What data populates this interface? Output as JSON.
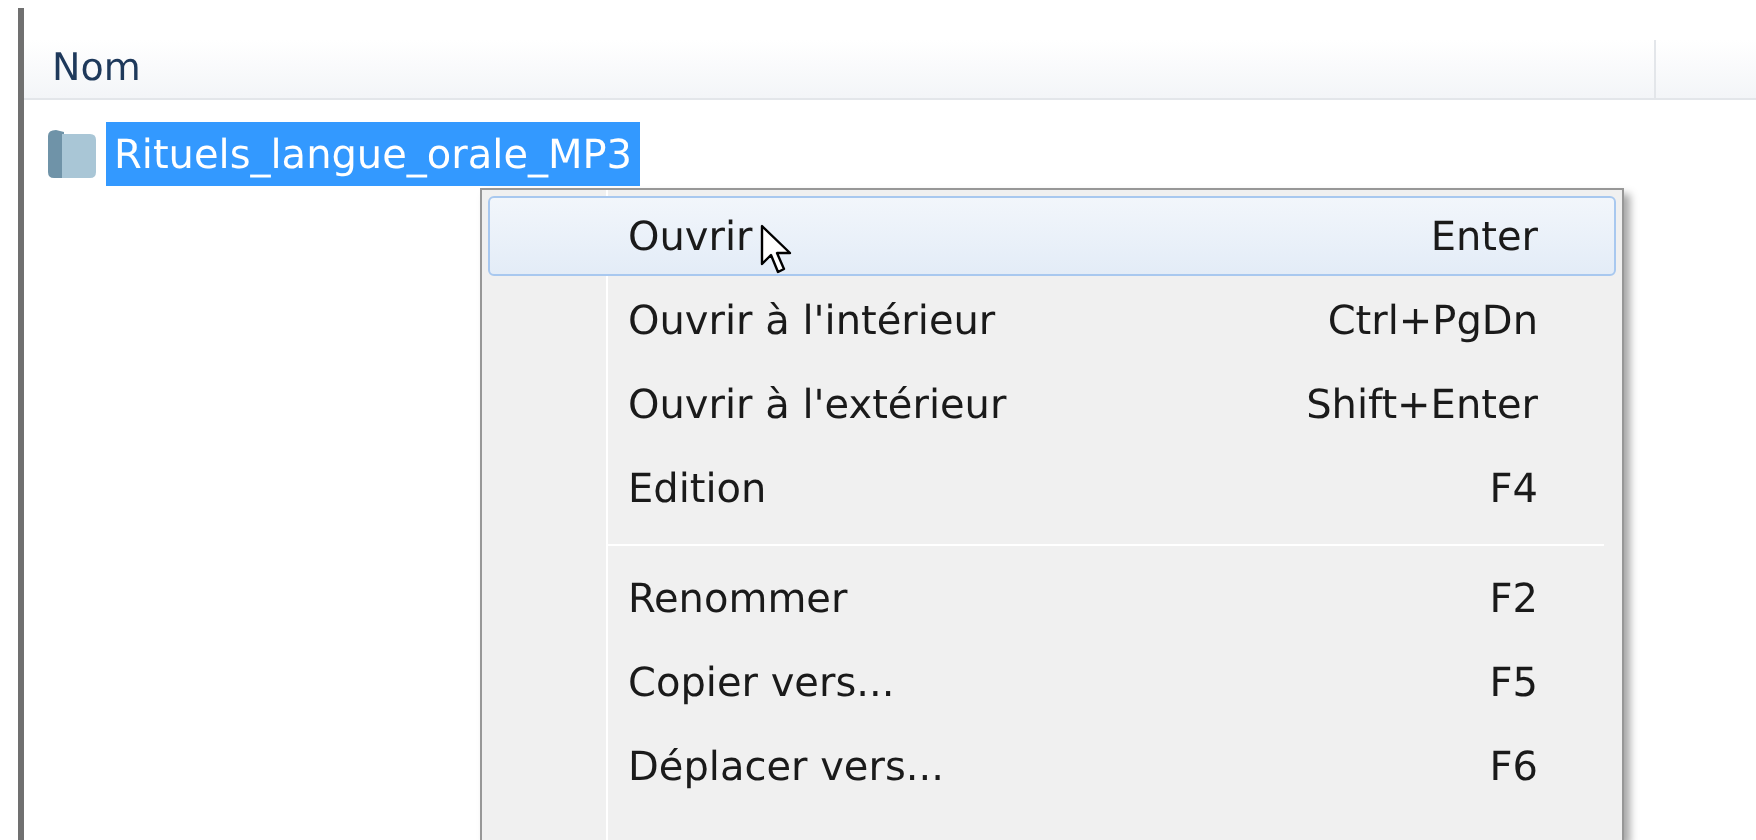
{
  "header": {
    "columns": [
      {
        "label": "Nom"
      }
    ]
  },
  "files": [
    {
      "name": "Rituels_langue_orale_MP3",
      "selected": true
    }
  ],
  "context_menu": {
    "items": [
      {
        "kind": "item",
        "label": "Ouvrir",
        "shortcut": "Enter",
        "selected": true
      },
      {
        "kind": "item",
        "label": "Ouvrir à l'intérieur",
        "shortcut": "Ctrl+PgDn",
        "selected": false
      },
      {
        "kind": "item",
        "label": "Ouvrir à l'extérieur",
        "shortcut": "Shift+Enter",
        "selected": false
      },
      {
        "kind": "item",
        "label": "Edition",
        "shortcut": "F4",
        "selected": false
      },
      {
        "kind": "separator"
      },
      {
        "kind": "item",
        "label": "Renommer",
        "shortcut": "F2",
        "selected": false
      },
      {
        "kind": "item",
        "label": "Copier vers...",
        "shortcut": "F5",
        "selected": false
      },
      {
        "kind": "item",
        "label": "Déplacer vers...",
        "shortcut": "F6",
        "selected": false
      }
    ]
  }
}
